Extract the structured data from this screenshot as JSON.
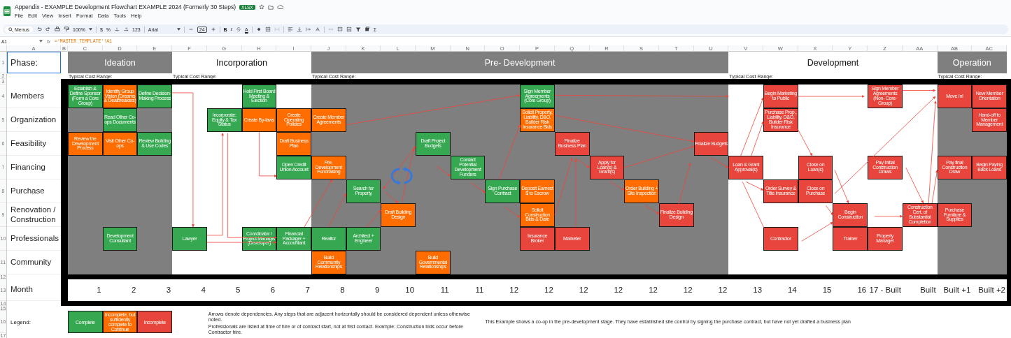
{
  "app": {
    "title": "Appendix - EXAMPLE Development Flowchart EXAMPLE 2024 (Formerly 30 Steps)",
    "badge": "XLSX",
    "menus": [
      "File",
      "Edit",
      "View",
      "Insert",
      "Format",
      "Data",
      "Tools",
      "Help"
    ]
  },
  "toolbar": {
    "search": "Menus",
    "zoom": "100%",
    "currency": "$",
    "percent": "%",
    "number_format": "123",
    "font": "Arial",
    "font_size": "24",
    "bold": "B",
    "italic": "I",
    "text_color": "A",
    "sum": "Σ"
  },
  "formula_bar": {
    "cell": "A1",
    "fx": "fx",
    "formula": "='MASTER TEMPLATE'!A1"
  },
  "sheet": {
    "label_columns": [
      "A",
      "B"
    ],
    "row_numbers": [
      "1",
      "2",
      "3",
      "4",
      "5",
      "6",
      "7",
      "8",
      "9",
      "10",
      "11",
      "12",
      "13",
      "14",
      "15",
      "16",
      "17"
    ],
    "phase_label": {
      "text": "Phase:",
      "selected": true
    },
    "row_labels": [
      "Members",
      "Organization",
      "Feasibility",
      "Financing",
      "Purchase",
      "Renovation / Construction",
      "Professionals",
      "Community"
    ],
    "month_label": "Month",
    "phases": [
      {
        "name": "Ideation",
        "shaded": true,
        "cost_label": "Typical Cost Range:",
        "columns": [
          {
            "letter": "C",
            "month": "1",
            "cells": [
              {
                "text": "Establish & Define Sponsor (Form a Core Group)",
                "color": "#36a852"
              },
              null,
              {
                "text": "Review the Development Process",
                "color": "#ff6d01"
              },
              null,
              null,
              null,
              null,
              null
            ]
          },
          {
            "letter": "D",
            "month": "2",
            "cells": [
              {
                "text": "Identify Group Vision (Dreams & Dealbreakers)",
                "color": "#ff6d01"
              },
              {
                "text": "Read Other Co-ops Documents",
                "color": "#36a852"
              },
              {
                "text": "Visit Other Co-ops",
                "color": "#ff6d01"
              },
              null,
              null,
              null,
              {
                "text": "Development Consultant",
                "color": "#36a852"
              },
              null
            ]
          },
          {
            "letter": "E",
            "month": "3",
            "cells": [
              {
                "text": "Define Decision-Making Process",
                "color": "#36a852"
              },
              null,
              {
                "text": "Review Building & Use Codes",
                "color": "#36a852"
              },
              null,
              null,
              null,
              null,
              null
            ]
          }
        ]
      },
      {
        "name": "Incorporation",
        "shaded": false,
        "cost_label": "Typical Cost Range:",
        "columns": [
          {
            "letter": "F",
            "month": "4",
            "cells": [
              null,
              null,
              null,
              null,
              null,
              null,
              {
                "text": "Lawyer",
                "color": "#36a852"
              },
              null
            ]
          },
          {
            "letter": "G",
            "month": "5",
            "cells": [
              null,
              {
                "text": "Incorporate: Equity & Tax Status",
                "color": "#36a852"
              },
              null,
              null,
              null,
              null,
              null,
              null
            ]
          },
          {
            "letter": "H",
            "month": "6",
            "cells": [
              {
                "text": "Hold First Board Meeting & Election",
                "color": "#36a852"
              },
              {
                "text": "Create By-laws",
                "color": "#ff6d01"
              },
              null,
              null,
              null,
              null,
              {
                "text": "Coordinator / Project Manager (Developer)",
                "color": "#36a852"
              },
              null
            ]
          },
          {
            "letter": "I",
            "month": "7",
            "cells": [
              null,
              {
                "text": "Create Operating Policies",
                "color": "#ff6d01"
              },
              {
                "text": "Draft Business Plan",
                "color": "#ff6d01"
              },
              {
                "text": "Open Credit Union Account",
                "color": "#36a852"
              },
              null,
              null,
              {
                "text": "Financial Packager + Accountant",
                "color": "#36a852"
              },
              null
            ]
          }
        ]
      },
      {
        "name": "Pre- Development",
        "shaded": true,
        "cost_label": "Typical Cost Range:",
        "columns": [
          {
            "letter": "J",
            "month": "8",
            "cells": [
              null,
              {
                "text": "Create Member Agreements",
                "color": "#ff6d01"
              },
              null,
              {
                "text": "Pre-Development Fundraising",
                "color": "#ff6d01"
              },
              null,
              null,
              {
                "text": "Realtor",
                "color": "#36a852"
              },
              {
                "text": "Build Community Relationships",
                "color": "#ff6d01"
              }
            ]
          },
          {
            "letter": "K",
            "month": "9",
            "cells": [
              null,
              null,
              null,
              null,
              {
                "text": "Search for Property",
                "color": "#36a852"
              },
              null,
              {
                "text": "Architect + Engineer",
                "color": "#36a852"
              },
              null
            ]
          },
          {
            "letter": "L",
            "month": "10",
            "cells": [
              null,
              null,
              null,
              null,
              null,
              {
                "text": "Draft Building Design",
                "color": "#ff6d01"
              },
              null,
              null
            ]
          },
          {
            "letter": "M",
            "month": "11",
            "cells": [
              null,
              null,
              {
                "text": "Draft Project Budgets",
                "color": "#36a852"
              },
              null,
              null,
              null,
              null,
              {
                "text": "Build Governmental Relationships",
                "color": "#ff6d01"
              }
            ]
          },
          {
            "letter": "N",
            "month": "11",
            "cells": [
              null,
              null,
              null,
              {
                "text": "Contact Potential Development Funders",
                "color": "#36a852"
              },
              null,
              null,
              null,
              null
            ]
          },
          {
            "letter": "O",
            "month": "12",
            "cells": [
              null,
              null,
              null,
              null,
              {
                "text": "Sign Purchase Contract",
                "color": "#36a852"
              },
              null,
              null,
              null
            ]
          },
          {
            "letter": "P",
            "month": "12",
            "cells": [
              {
                "text": "Sign Member Agreements (Core Group)",
                "color": "#36a852"
              },
              {
                "text": "Solicit Property, Liability, D&O, Builder Risk Insurance Bids",
                "color": "#ff6d01"
              },
              null,
              null,
              {
                "text": "Deposit Earnest $ to Escrow",
                "color": "#ff6d01"
              },
              {
                "text": "Solicit Construction Bids & Date",
                "color": "#ff6d01"
              },
              {
                "text": "Insurance Broker",
                "color": "#e8453c"
              },
              null
            ]
          },
          {
            "letter": "Q",
            "month": "12",
            "cells": [
              null,
              null,
              {
                "text": "Finalize Business Plan",
                "color": "#e8453c"
              },
              null,
              null,
              null,
              {
                "text": "Marketer",
                "color": "#e8453c"
              },
              null
            ]
          },
          {
            "letter": "R",
            "month": "12",
            "cells": [
              null,
              null,
              null,
              {
                "text": "Apply for Loan(s) & Grant(s)",
                "color": "#e8453c"
              },
              null,
              null,
              null,
              null
            ]
          },
          {
            "letter": "S",
            "month": "12",
            "cells": [
              null,
              null,
              null,
              null,
              {
                "text": "Order Building + Site Inspection",
                "color": "#ff6d01"
              },
              null,
              null,
              null
            ]
          },
          {
            "letter": "T",
            "month": "12",
            "cells": [
              null,
              null,
              null,
              null,
              null,
              {
                "text": "Finalize Building Design",
                "color": "#e8453c"
              },
              null,
              null
            ]
          },
          {
            "letter": "U",
            "month": "12",
            "cells": [
              null,
              null,
              {
                "text": "Finalize Budgets",
                "color": "#e8453c"
              },
              null,
              null,
              null,
              null,
              null
            ]
          }
        ]
      },
      {
        "name": "Development",
        "shaded": false,
        "cost_label": "Typical Cost Range:",
        "columns": [
          {
            "letter": "V",
            "month": "13",
            "cells": [
              null,
              null,
              null,
              {
                "text": "Loan & Grant Approval(s)",
                "color": "#e8453c"
              },
              null,
              null,
              null,
              null
            ]
          },
          {
            "letter": "W",
            "month": "14",
            "cells": [
              {
                "text": "Begin Marketing to Public",
                "color": "#e8453c"
              },
              {
                "text": "Purchase Prop., Liability, D&O, Builder Risk Insurance",
                "color": "#e8453c"
              },
              null,
              null,
              {
                "text": "Order Survey & Title Insurance",
                "color": "#e8453c"
              },
              null,
              {
                "text": "Contractor",
                "color": "#e8453c"
              },
              null
            ]
          },
          {
            "letter": "X",
            "month": "15",
            "cells": [
              null,
              null,
              null,
              {
                "text": "Close on Loan(s)",
                "color": "#e8453c"
              },
              {
                "text": "Close on Purchase",
                "color": "#e8453c"
              },
              null,
              null,
              null
            ]
          },
          {
            "letter": "Y",
            "month": "16",
            "cells": [
              null,
              null,
              null,
              null,
              null,
              {
                "text": "Begin Construction",
                "color": "#e8453c"
              },
              {
                "text": "Trainer",
                "color": "#e8453c"
              },
              null
            ]
          },
          {
            "letter": "Z",
            "month": "17 - Built",
            "cells": [
              {
                "text": "Sign Member Agreements (Non- Core-Group)",
                "color": "#e8453c"
              },
              null,
              null,
              {
                "text": "Pay Initial Construction Draws",
                "color": "#e8453c"
              },
              null,
              null,
              {
                "text": "Property Manager",
                "color": "#e8453c"
              },
              null
            ]
          },
          {
            "letter": "AA",
            "month": "Built",
            "cells": [
              null,
              null,
              null,
              null,
              null,
              {
                "text": "Construction Cert. of Substantial Completion",
                "color": "#e8453c"
              },
              null,
              null
            ]
          }
        ]
      },
      {
        "name": "Operation",
        "shaded": true,
        "cost_label": "Typical Cost Range:",
        "columns": [
          {
            "letter": "AB",
            "month": "Built +1",
            "cells": [
              {
                "text": "Move In!",
                "color": "#e8453c"
              },
              null,
              null,
              {
                "text": "Pay final Construction Draw",
                "color": "#e8453c"
              },
              null,
              {
                "text": "Purchase Furniture & Supplies",
                "color": "#e8453c"
              },
              null,
              null
            ]
          },
          {
            "letter": "AC",
            "month": "Built +2",
            "cells": [
              {
                "text": "New Member Orientation",
                "color": "#e8453c"
              },
              {
                "text": "Hand-off to Member Management",
                "color": "#e8453c"
              },
              null,
              {
                "text": "Begin Paying Back Loans",
                "color": "#e8453c"
              },
              null,
              null,
              null,
              null
            ]
          }
        ]
      }
    ],
    "legend": {
      "label": "Legend:",
      "items": [
        {
          "text": "Complete",
          "color": "#36a852"
        },
        {
          "text": "Incomplete, but sufficiently complete to Continue",
          "color": "#ff6d01"
        },
        {
          "text": "Incomplete",
          "color": "#e8453c"
        }
      ],
      "notes": [
        "Arrows denote dependencies. Any steps that are adjacent horizontally should be considered dependent unless otherwise noted.",
        "Professionals are listed at time of hire or of contract start, not at first contact. Example: Construction bids occur before Contractor hire."
      ],
      "example": "This Example shows a co-op in the pre-development stage. They have established site control by signing the purchase contract, but have not yet drafted a business plan"
    }
  }
}
